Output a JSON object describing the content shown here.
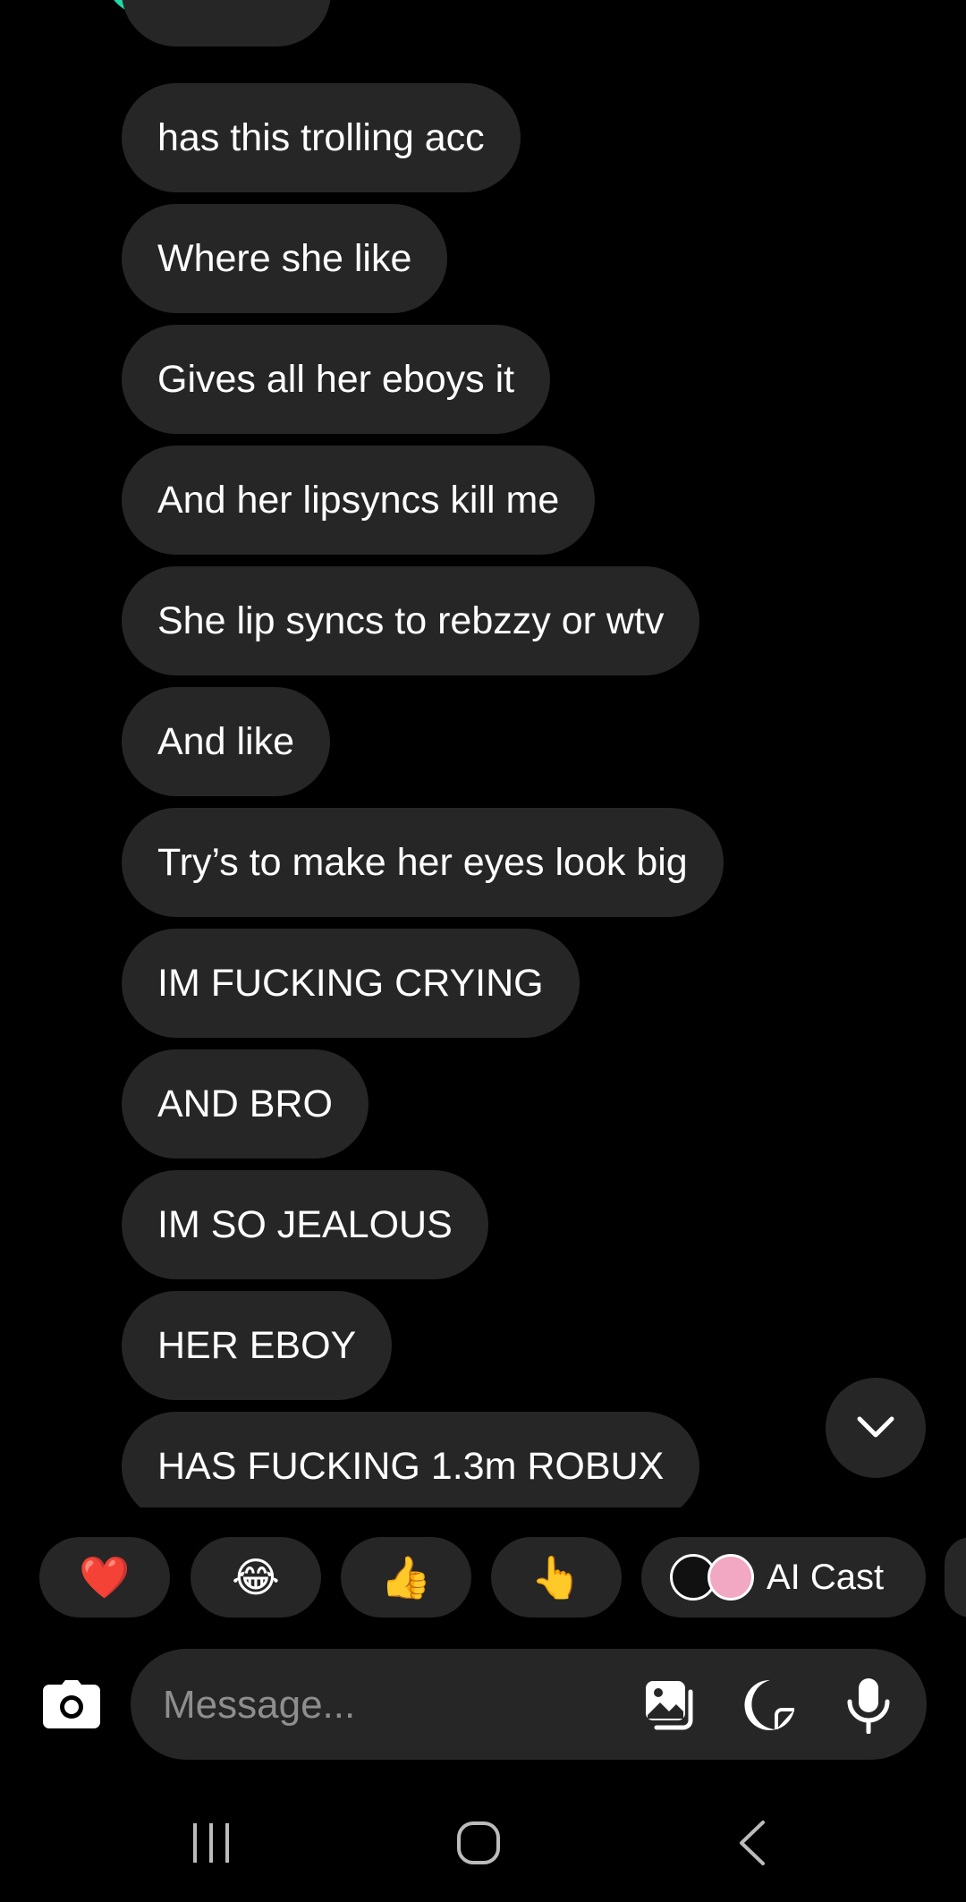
{
  "messages": [
    "has this trolling acc",
    "Where she like",
    "Gives all her eboys it",
    "And her lipsyncs kill me",
    "She lip syncs to rebzzy or wtv",
    "And like",
    "Try’s to make her eyes look big",
    "IM FUCKING CRYING",
    "AND BRO",
    "IM SO JEALOUS",
    "HER EBOY",
    "HAS FUCKING 1.3m ROBUX"
  ],
  "quick_reactions": [
    "❤️",
    "😂",
    "👍",
    "👆"
  ],
  "ai_cast_label": "AI Cast",
  "composer": {
    "placeholder": "Message..."
  },
  "colors": {
    "background": "#000000",
    "bubble": "#262626",
    "text": "#ffffff",
    "placeholder": "#8e8e8e",
    "avatar_ring": "#1fd8a8"
  },
  "icons": {
    "scroll_down": "chevron-down-icon",
    "camera": "camera-icon",
    "gallery": "gallery-icon",
    "sticker": "sticker-icon",
    "microphone": "microphone-icon",
    "nav_recents": "recents-icon",
    "nav_home": "home-icon",
    "nav_back": "back-icon"
  }
}
